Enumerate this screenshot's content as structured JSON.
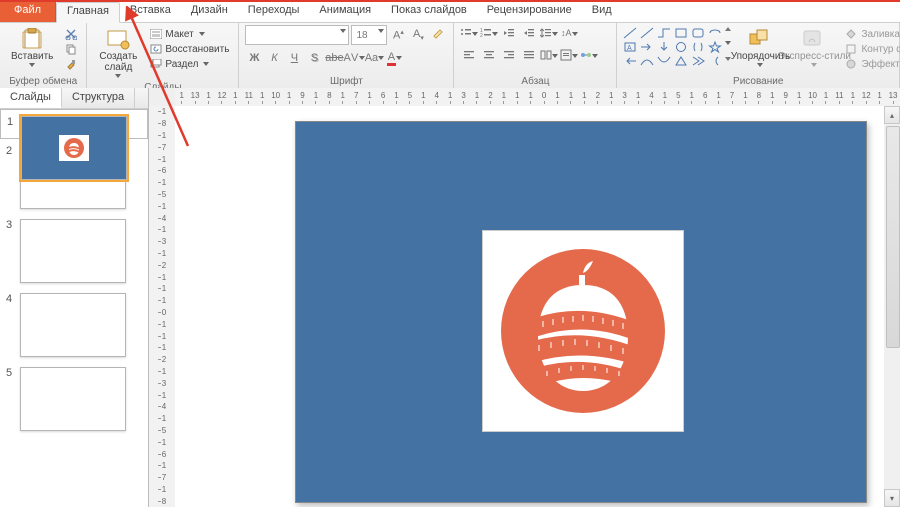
{
  "tabs": {
    "file": "Файл",
    "home": "Главная",
    "insert": "Вставка",
    "design": "Дизайн",
    "transitions": "Переходы",
    "animation": "Анимация",
    "slideshow": "Показ слайдов",
    "review": "Рецензирование",
    "view": "Вид"
  },
  "ribbon": {
    "clipboard": {
      "paste": "Вставить",
      "label": "Буфер обмена"
    },
    "slides": {
      "new_slide": "Создать\nслайд",
      "layout": "Макет",
      "reset": "Восстановить",
      "section": "Раздел",
      "label": "Слайды"
    },
    "font": {
      "name_placeholder": "",
      "size": "18",
      "label": "Шрифт",
      "bold": "Ж",
      "italic": "К",
      "underline": "Ч",
      "strike": "abe",
      "shadow": "S"
    },
    "paragraph": {
      "label": "Абзац"
    },
    "drawing": {
      "arrange": "Упорядочить",
      "quick_styles": "Экспресс-стили",
      "fill": "Заливка фигуры",
      "outline": "Контур фигуры",
      "effects": "Эффекты фигур",
      "label": "Рисование"
    }
  },
  "thumb_tabs": {
    "slides": "Слайды",
    "outline": "Структура"
  },
  "slides_list": [
    1,
    2,
    3,
    4,
    5
  ],
  "ruler_h": [
    "1",
    "13",
    "1",
    "12",
    "1",
    "11",
    "1",
    "10",
    "1",
    "9",
    "1",
    "8",
    "1",
    "7",
    "1",
    "6",
    "1",
    "5",
    "1",
    "4",
    "1",
    "3",
    "1",
    "2",
    "1",
    "1",
    "1",
    "0",
    "1",
    "1",
    "1",
    "2",
    "1",
    "3",
    "1",
    "4",
    "1",
    "5",
    "1",
    "6",
    "1",
    "7",
    "1",
    "8",
    "1",
    "9",
    "1",
    "10",
    "1",
    "11",
    "1",
    "12",
    "1",
    "13"
  ],
  "ruler_v": [
    "1",
    "8",
    "1",
    "7",
    "1",
    "6",
    "1",
    "5",
    "1",
    "4",
    "1",
    "3",
    "1",
    "2",
    "1",
    "1",
    "1",
    "0",
    "1",
    "1",
    "1",
    "2",
    "1",
    "3",
    "1",
    "4",
    "1",
    "5",
    "1",
    "6",
    "1",
    "7",
    "1",
    "8"
  ],
  "colors": {
    "slide_bg": "#4472a3",
    "accent": "#e96036",
    "apple": "#e46a4b"
  }
}
